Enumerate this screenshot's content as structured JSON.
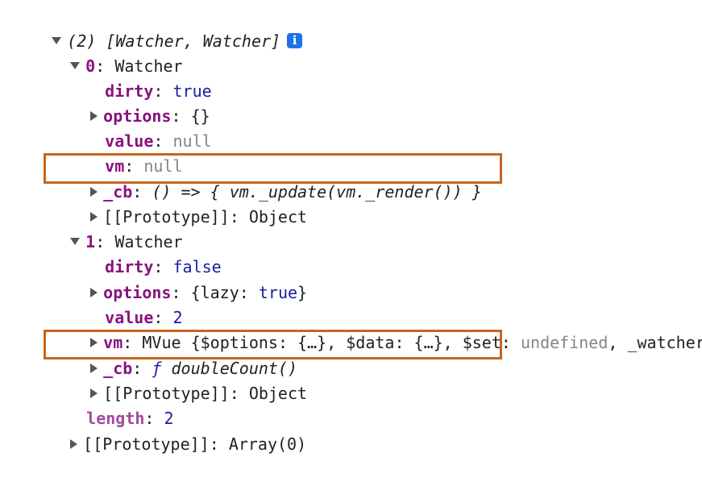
{
  "header": {
    "count": "(2)",
    "summary": "[Watcher, Watcher]",
    "info_icon": "i"
  },
  "items": [
    {
      "index": "0",
      "type": "Watcher",
      "dirty": "true",
      "options": "{}",
      "value": "null",
      "vm": "null",
      "cb": "() => { vm._update(vm._render()) }"
    },
    {
      "index": "1",
      "type": "Watcher",
      "dirty": "false",
      "options_open": "{lazy: ",
      "options_val": "true",
      "options_close": "}",
      "value": "2",
      "vm_class": "MVue",
      "vm_p1": "{$options: {…}, $data: {…}, $set: ",
      "vm_undef": "undefined",
      "vm_p2": ", _watcher",
      "cb_fn": "ƒ",
      "cb_name": "doubleCount()"
    }
  ],
  "labels": {
    "dirty": "dirty",
    "options": "options",
    "value": "value",
    "vm": "vm",
    "cb": "_cb",
    "prototype": "[[Prototype]]",
    "object": "Object",
    "length": "length",
    "array": "Array(0)"
  },
  "length_value": "2",
  "colors": {
    "highlight": "#c8651b",
    "key": "#881280",
    "keyword": "#1a1aa6",
    "muted": "#80868b"
  }
}
